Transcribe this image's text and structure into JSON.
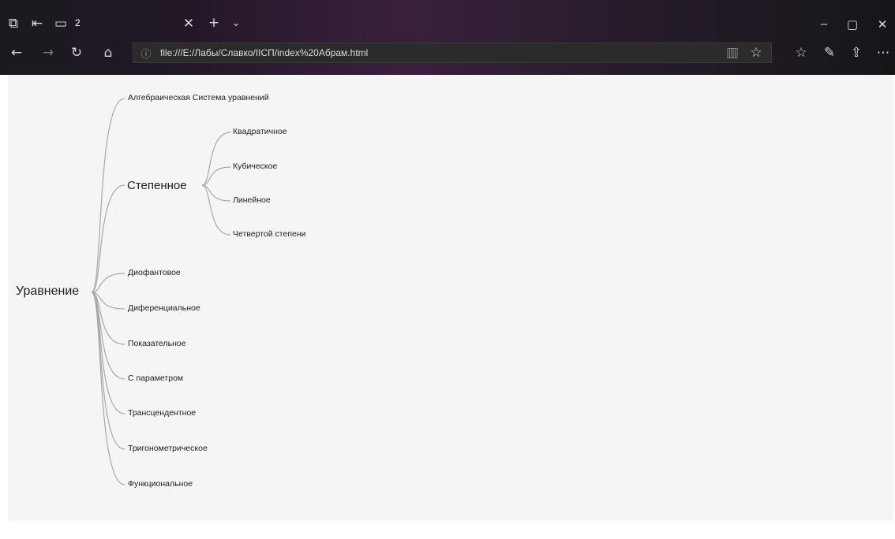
{
  "browser": {
    "tab_count": "2",
    "url": "file:///E:/Лабы/Славко/IIСП/index%20Абрам.html",
    "icons": {
      "tab_actions": "tabs-aside-icon",
      "set_aside": "set-aside-icon",
      "tab_preview": "tab-preview-icon",
      "close_tab": "close-icon",
      "new_tab": "plus-icon",
      "tab_list": "chevron-down-icon",
      "back": "back-arrow-icon",
      "forward": "forward-arrow-icon",
      "refresh": "refresh-icon",
      "home": "home-icon",
      "info": "info-icon",
      "reading_view": "reading-view-icon",
      "favorite": "star-icon",
      "favorites_list": "favorites-list-icon",
      "notes": "pen-icon",
      "share": "share-icon",
      "more": "more-icon",
      "minimize": "minimize-icon",
      "maximize": "maximize-icon",
      "close_window": "close-icon"
    }
  },
  "mindmap": {
    "root": "Уравнение",
    "children": [
      {
        "label": "Алгебраическая Система уравнений"
      },
      {
        "label": "Степенное",
        "children": [
          "Квадратичное",
          "Кубическое",
          "Линейное",
          "Четвертой степени"
        ]
      },
      {
        "label": "Диофантовое"
      },
      {
        "label": "Диференциальное"
      },
      {
        "label": "Показательное"
      },
      {
        "label": "С параметром"
      },
      {
        "label": "Трансцендентное"
      },
      {
        "label": "Тригонометрическое"
      },
      {
        "label": "Функциональное"
      }
    ]
  },
  "colors": {
    "link": "#a8a8a8",
    "canvas": "#f5f5f5"
  }
}
